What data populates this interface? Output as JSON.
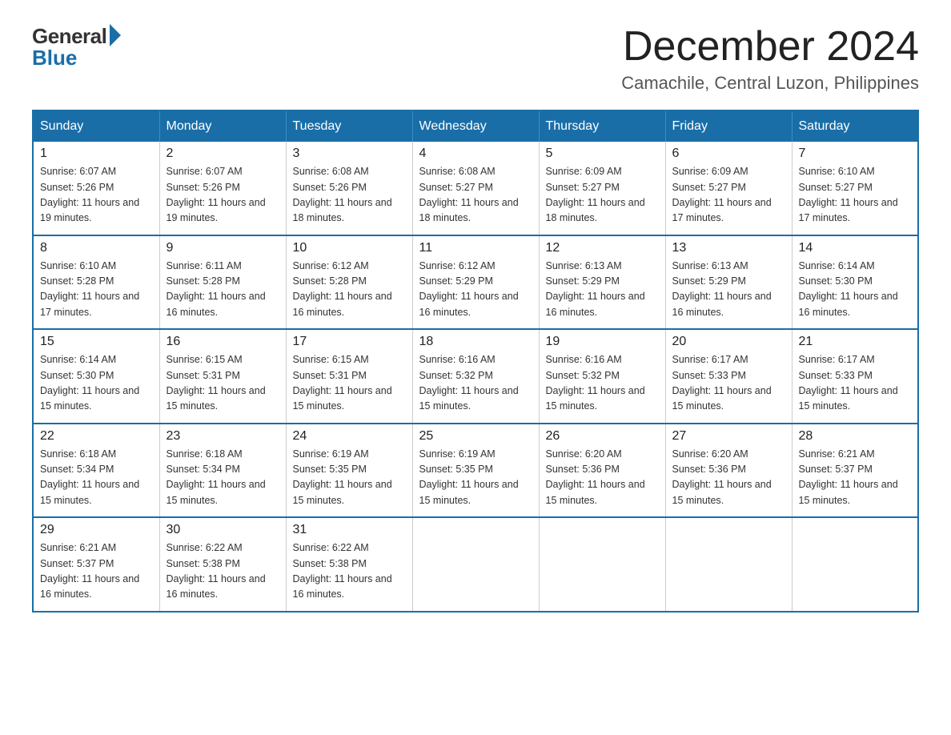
{
  "logo": {
    "general": "General",
    "blue": "Blue"
  },
  "title": {
    "month": "December 2024",
    "location": "Camachile, Central Luzon, Philippines"
  },
  "days_of_week": [
    "Sunday",
    "Monday",
    "Tuesday",
    "Wednesday",
    "Thursday",
    "Friday",
    "Saturday"
  ],
  "weeks": [
    [
      {
        "day": "1",
        "sunrise": "6:07 AM",
        "sunset": "5:26 PM",
        "daylight": "11 hours and 19 minutes."
      },
      {
        "day": "2",
        "sunrise": "6:07 AM",
        "sunset": "5:26 PM",
        "daylight": "11 hours and 19 minutes."
      },
      {
        "day": "3",
        "sunrise": "6:08 AM",
        "sunset": "5:26 PM",
        "daylight": "11 hours and 18 minutes."
      },
      {
        "day": "4",
        "sunrise": "6:08 AM",
        "sunset": "5:27 PM",
        "daylight": "11 hours and 18 minutes."
      },
      {
        "day": "5",
        "sunrise": "6:09 AM",
        "sunset": "5:27 PM",
        "daylight": "11 hours and 18 minutes."
      },
      {
        "day": "6",
        "sunrise": "6:09 AM",
        "sunset": "5:27 PM",
        "daylight": "11 hours and 17 minutes."
      },
      {
        "day": "7",
        "sunrise": "6:10 AM",
        "sunset": "5:27 PM",
        "daylight": "11 hours and 17 minutes."
      }
    ],
    [
      {
        "day": "8",
        "sunrise": "6:10 AM",
        "sunset": "5:28 PM",
        "daylight": "11 hours and 17 minutes."
      },
      {
        "day": "9",
        "sunrise": "6:11 AM",
        "sunset": "5:28 PM",
        "daylight": "11 hours and 16 minutes."
      },
      {
        "day": "10",
        "sunrise": "6:12 AM",
        "sunset": "5:28 PM",
        "daylight": "11 hours and 16 minutes."
      },
      {
        "day": "11",
        "sunrise": "6:12 AM",
        "sunset": "5:29 PM",
        "daylight": "11 hours and 16 minutes."
      },
      {
        "day": "12",
        "sunrise": "6:13 AM",
        "sunset": "5:29 PM",
        "daylight": "11 hours and 16 minutes."
      },
      {
        "day": "13",
        "sunrise": "6:13 AM",
        "sunset": "5:29 PM",
        "daylight": "11 hours and 16 minutes."
      },
      {
        "day": "14",
        "sunrise": "6:14 AM",
        "sunset": "5:30 PM",
        "daylight": "11 hours and 16 minutes."
      }
    ],
    [
      {
        "day": "15",
        "sunrise": "6:14 AM",
        "sunset": "5:30 PM",
        "daylight": "11 hours and 15 minutes."
      },
      {
        "day": "16",
        "sunrise": "6:15 AM",
        "sunset": "5:31 PM",
        "daylight": "11 hours and 15 minutes."
      },
      {
        "day": "17",
        "sunrise": "6:15 AM",
        "sunset": "5:31 PM",
        "daylight": "11 hours and 15 minutes."
      },
      {
        "day": "18",
        "sunrise": "6:16 AM",
        "sunset": "5:32 PM",
        "daylight": "11 hours and 15 minutes."
      },
      {
        "day": "19",
        "sunrise": "6:16 AM",
        "sunset": "5:32 PM",
        "daylight": "11 hours and 15 minutes."
      },
      {
        "day": "20",
        "sunrise": "6:17 AM",
        "sunset": "5:33 PM",
        "daylight": "11 hours and 15 minutes."
      },
      {
        "day": "21",
        "sunrise": "6:17 AM",
        "sunset": "5:33 PM",
        "daylight": "11 hours and 15 minutes."
      }
    ],
    [
      {
        "day": "22",
        "sunrise": "6:18 AM",
        "sunset": "5:34 PM",
        "daylight": "11 hours and 15 minutes."
      },
      {
        "day": "23",
        "sunrise": "6:18 AM",
        "sunset": "5:34 PM",
        "daylight": "11 hours and 15 minutes."
      },
      {
        "day": "24",
        "sunrise": "6:19 AM",
        "sunset": "5:35 PM",
        "daylight": "11 hours and 15 minutes."
      },
      {
        "day": "25",
        "sunrise": "6:19 AM",
        "sunset": "5:35 PM",
        "daylight": "11 hours and 15 minutes."
      },
      {
        "day": "26",
        "sunrise": "6:20 AM",
        "sunset": "5:36 PM",
        "daylight": "11 hours and 15 minutes."
      },
      {
        "day": "27",
        "sunrise": "6:20 AM",
        "sunset": "5:36 PM",
        "daylight": "11 hours and 15 minutes."
      },
      {
        "day": "28",
        "sunrise": "6:21 AM",
        "sunset": "5:37 PM",
        "daylight": "11 hours and 15 minutes."
      }
    ],
    [
      {
        "day": "29",
        "sunrise": "6:21 AM",
        "sunset": "5:37 PM",
        "daylight": "11 hours and 16 minutes."
      },
      {
        "day": "30",
        "sunrise": "6:22 AM",
        "sunset": "5:38 PM",
        "daylight": "11 hours and 16 minutes."
      },
      {
        "day": "31",
        "sunrise": "6:22 AM",
        "sunset": "5:38 PM",
        "daylight": "11 hours and 16 minutes."
      },
      null,
      null,
      null,
      null
    ]
  ]
}
